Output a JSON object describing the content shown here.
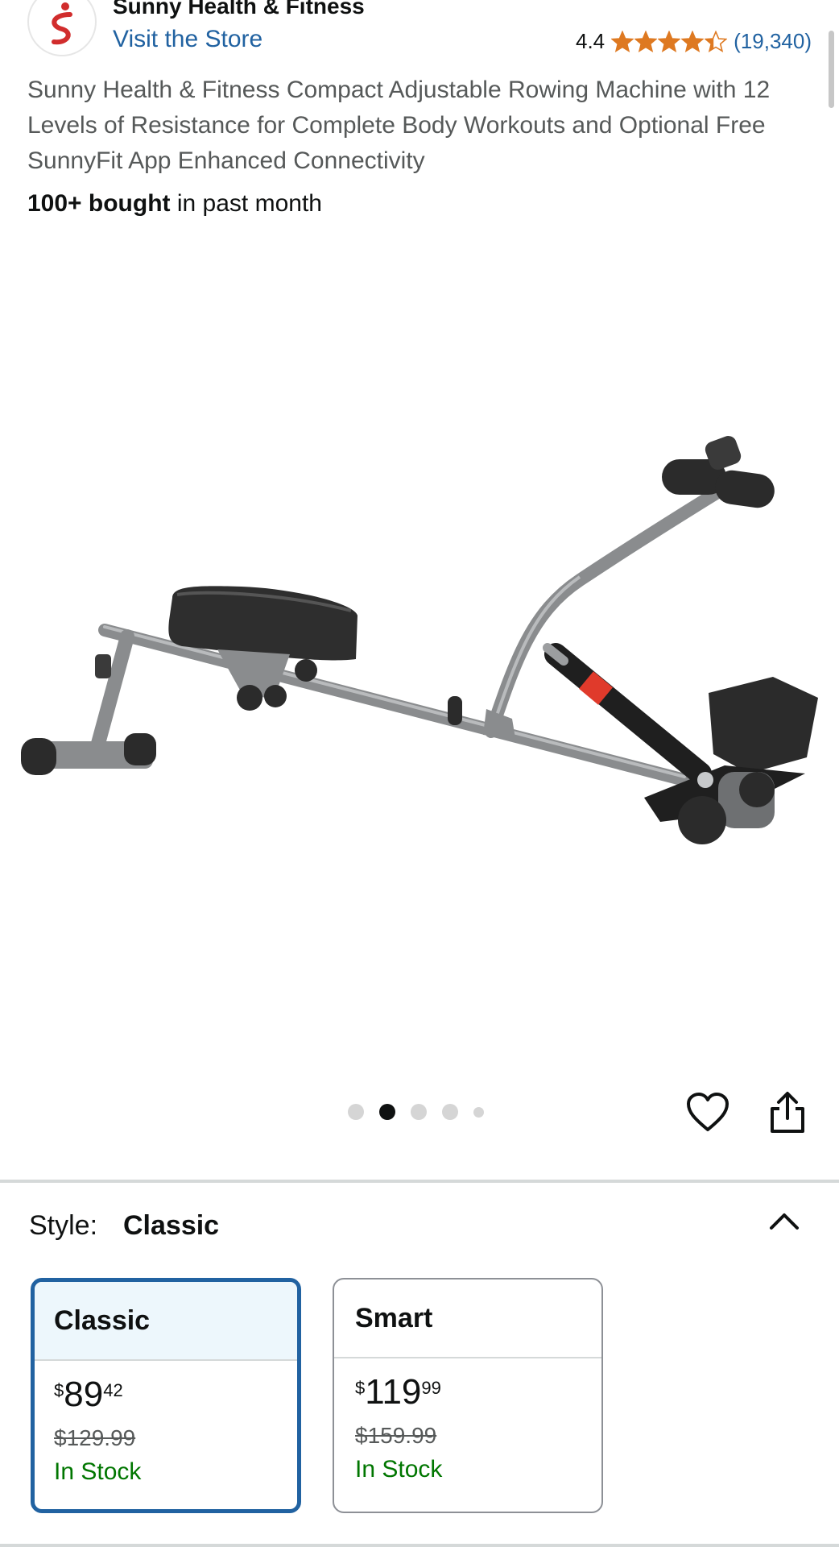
{
  "brand": {
    "name": "Sunny Health & Fitness",
    "visit_store": "Visit the Store",
    "logo_accent": "#d12d2d"
  },
  "rating": {
    "value": "4.4",
    "stars_filled": 4.4,
    "review_count": "(19,340)",
    "star_color": "#de7921"
  },
  "product": {
    "title": "Sunny Health & Fitness Compact Adjustable Rowing Machine with 12 Levels of Resistance for Complete Body Workouts and Optional Free SunnyFit App Enhanced Connectivity",
    "bought_strong": "100+ bought",
    "bought_rest": " in past month",
    "image_icon": "rowing-machine-image"
  },
  "carousel": {
    "dot_count": 5,
    "active_index": 1
  },
  "actions": {
    "wishlist_icon": "heart-icon",
    "share_icon": "share-icon"
  },
  "style_selector": {
    "label": "Style:",
    "selected": "Classic",
    "collapse_icon": "chevron-up-icon",
    "options": [
      {
        "name": "Classic",
        "price_symbol": "$",
        "price_whole": "89",
        "price_fraction": "42",
        "list_price": "$129.99",
        "availability": "In Stock",
        "selected": true
      },
      {
        "name": "Smart",
        "price_symbol": "$",
        "price_whole": "119",
        "price_fraction": "99",
        "list_price": "$159.99",
        "availability": "In Stock",
        "selected": false
      }
    ]
  },
  "colors": {
    "link": "#2162a1",
    "in_stock": "#007600",
    "selected_border": "#2162a1",
    "selected_header_bg": "#edf7fc"
  }
}
